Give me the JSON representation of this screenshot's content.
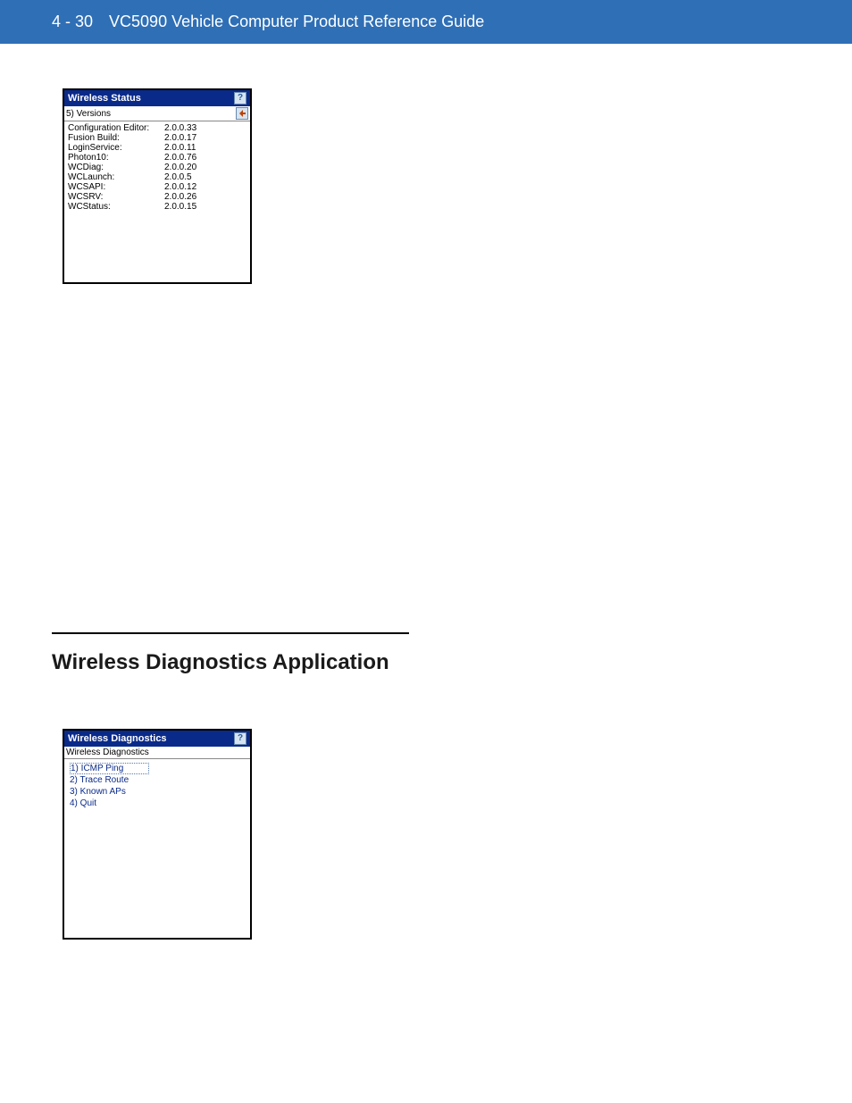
{
  "header": {
    "page_number": "4 - 30",
    "title": "VC5090 Vehicle Computer Product Reference Guide"
  },
  "status_window": {
    "title": "Wireless Status",
    "subtitle": "5) Versions",
    "rows": [
      {
        "label": "Configuration Editor:",
        "value": "2.0.0.33"
      },
      {
        "label": "Fusion Build:",
        "value": "2.0.0.17"
      },
      {
        "label": "LoginService:",
        "value": "2.0.0.11"
      },
      {
        "label": "Photon10:",
        "value": "2.0.0.76"
      },
      {
        "label": "WCDiag:",
        "value": "2.0.0.20"
      },
      {
        "label": "WCLaunch:",
        "value": "2.0.0.5"
      },
      {
        "label": "WCSAPI:",
        "value": "2.0.0.12"
      },
      {
        "label": "WCSRV:",
        "value": "2.0.0.26"
      },
      {
        "label": "WCStatus:",
        "value": "2.0.0.15"
      }
    ]
  },
  "section_heading": "Wireless Diagnostics Application",
  "diag_window": {
    "title": "Wireless Diagnostics",
    "subtitle": "Wireless Diagnostics",
    "items": [
      "1) ICMP Ping",
      "2) Trace Route",
      "3) Known APs",
      "4) Quit"
    ]
  },
  "icons": {
    "help": "?",
    "back": "back-arrow-icon"
  }
}
